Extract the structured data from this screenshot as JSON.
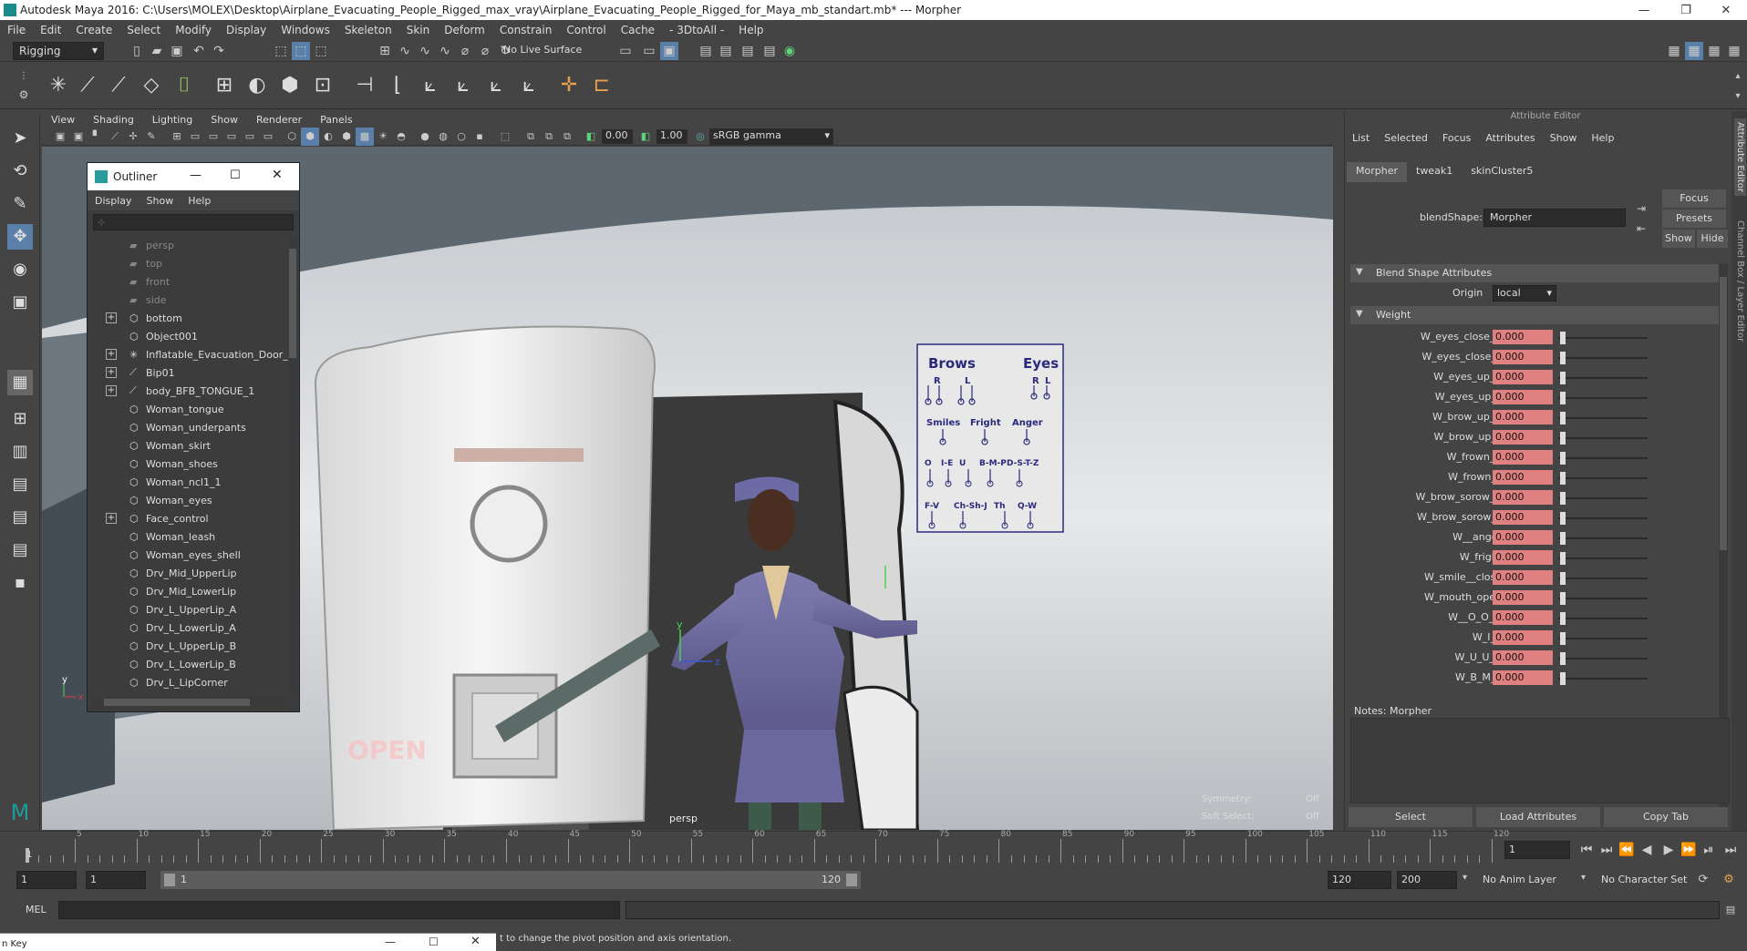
{
  "window": {
    "title": "Autodesk Maya 2016: C:\\Users\\MOLEX\\Desktop\\Airplane_Evacuating_People_Rigged_max_vray\\Airplane_Evacuating_People_Rigged_for_Maya_mb_standart.mb*   ---   Morpher",
    "minimize": "—",
    "restore": "❐",
    "close": "✕"
  },
  "menubar": [
    "File",
    "Edit",
    "Create",
    "Select",
    "Modify",
    "Display",
    "Windows",
    "Skeleton",
    "Skin",
    "Deform",
    "Constrain",
    "Control",
    "Cache",
    "- 3DtoAll -",
    "Help"
  ],
  "toolbar": {
    "mode": "Rigging",
    "live_surface": "No Live Surface"
  },
  "viewport": {
    "menu": [
      "View",
      "Shading",
      "Lighting",
      "Show",
      "Renderer",
      "Panels"
    ],
    "near_value": "0.00",
    "far_value": "1.00",
    "color_space": "sRGB gamma",
    "camera_label": "persp",
    "symmetry_label": "Symmetry:",
    "symmetry_value": "Off",
    "soft_select_label": "Soft Select:",
    "soft_select_value": "Off",
    "axis_y": "y",
    "axis_z": "z",
    "axis_x": "x",
    "face_board": {
      "brows": "Brows",
      "eyes": "Eyes",
      "r1": "R",
      "l1": "L",
      "r2": "R",
      "l2": "L",
      "smiles": "Smiles",
      "fright": "Fright",
      "anger": "Anger",
      "row3": [
        "O",
        "I-E",
        "U",
        "B-M-P",
        "D-S-T-Z"
      ],
      "row4": [
        "F-V",
        "Ch-Sh-J",
        "Th",
        "Q-W"
      ]
    },
    "door_text": "OPEN"
  },
  "outliner": {
    "title": "Outliner",
    "menus": [
      "Display",
      "Show",
      "Help"
    ],
    "items": [
      {
        "label": "persp",
        "icon": "camera-icon",
        "expand": "",
        "dim": true
      },
      {
        "label": "top",
        "icon": "camera-icon",
        "expand": "",
        "dim": true
      },
      {
        "label": "front",
        "icon": "camera-icon",
        "expand": "",
        "dim": true
      },
      {
        "label": "side",
        "icon": "camera-icon",
        "expand": "",
        "dim": true
      },
      {
        "label": "bottom",
        "icon": "mesh-icon",
        "expand": "+",
        "dim": false
      },
      {
        "label": "Object001",
        "icon": "mesh-icon",
        "expand": "",
        "dim": false
      },
      {
        "label": "Inflatable_Evacuation_Door_S",
        "icon": "star-icon",
        "expand": "+",
        "dim": false
      },
      {
        "label": "Bip01",
        "icon": "joint-icon",
        "expand": "+",
        "dim": false
      },
      {
        "label": "body_BFB_TONGUE_1",
        "icon": "joint-icon",
        "expand": "+",
        "dim": false
      },
      {
        "label": "Woman_tongue",
        "icon": "mesh-icon",
        "expand": "",
        "dim": false
      },
      {
        "label": "Woman_underpants",
        "icon": "mesh-icon",
        "expand": "",
        "dim": false
      },
      {
        "label": "Woman_skirt",
        "icon": "mesh-icon",
        "expand": "",
        "dim": false
      },
      {
        "label": "Woman_shoes",
        "icon": "mesh-icon",
        "expand": "",
        "dim": false
      },
      {
        "label": "Woman_ncl1_1",
        "icon": "mesh-icon",
        "expand": "",
        "dim": false
      },
      {
        "label": "Woman_eyes",
        "icon": "mesh-icon",
        "expand": "",
        "dim": false
      },
      {
        "label": "Face_control",
        "icon": "mesh-icon",
        "expand": "+",
        "dim": false
      },
      {
        "label": "Woman_leash",
        "icon": "mesh-icon",
        "expand": "",
        "dim": false
      },
      {
        "label": "Woman_eyes_shell",
        "icon": "mesh-icon",
        "expand": "",
        "dim": false
      },
      {
        "label": "Drv_Mid_UpperLip",
        "icon": "mesh-icon",
        "expand": "",
        "dim": false
      },
      {
        "label": "Drv_Mid_LowerLip",
        "icon": "mesh-icon",
        "expand": "",
        "dim": false
      },
      {
        "label": "Drv_L_UpperLip_A",
        "icon": "mesh-icon",
        "expand": "",
        "dim": false
      },
      {
        "label": "Drv_L_LowerLip_A",
        "icon": "mesh-icon",
        "expand": "",
        "dim": false
      },
      {
        "label": "Drv_L_UpperLip_B",
        "icon": "mesh-icon",
        "expand": "",
        "dim": false
      },
      {
        "label": "Drv_L_LowerLip_B",
        "icon": "mesh-icon",
        "expand": "",
        "dim": false
      },
      {
        "label": "Drv_L_LipCorner",
        "icon": "mesh-icon",
        "expand": "",
        "dim": false
      }
    ]
  },
  "attribute_editor": {
    "title": "Attribute Editor",
    "menus": [
      "List",
      "Selected",
      "Focus",
      "Attributes",
      "Show",
      "Help"
    ],
    "tabs": [
      "Morpher",
      "tweak1",
      "skinCluster5"
    ],
    "active_tab": "Morpher",
    "blendshape_label": "blendShape:",
    "blendshape_value": "Morpher",
    "focus_btn": "Focus",
    "presets_btn": "Presets",
    "show_btn": "Show",
    "hide_btn": "Hide",
    "section_blend": "Blend Shape Attributes",
    "origin_label": "Origin",
    "origin_value": "local",
    "section_weight": "Weight",
    "weights": [
      {
        "name": "W_eyes_close_R",
        "value": "0.000"
      },
      {
        "name": "W_eyes_close_L",
        "value": "0.000"
      },
      {
        "name": "W_eyes_up_R",
        "value": "0.000"
      },
      {
        "name": "W_eyes_up_L",
        "value": "0.000"
      },
      {
        "name": "W_brow_up_R",
        "value": "0.000"
      },
      {
        "name": "W_brow_up_L",
        "value": "0.000"
      },
      {
        "name": "W_frown_R",
        "value": "0.000"
      },
      {
        "name": "W_frown_L",
        "value": "0.000"
      },
      {
        "name": "W_brow_sorow_R",
        "value": "0.000"
      },
      {
        "name": "W_brow_sorow_L",
        "value": "0.000"
      },
      {
        "name": "W__anger",
        "value": "0.000"
      },
      {
        "name": "W_fright",
        "value": "0.000"
      },
      {
        "name": "W_smile__close",
        "value": "0.000"
      },
      {
        "name": "W_mouth_open",
        "value": "0.000"
      },
      {
        "name": "W__O_O_O",
        "value": "0.000"
      },
      {
        "name": "W_I_E",
        "value": "0.000"
      },
      {
        "name": "W_U_U_U",
        "value": "0.000"
      },
      {
        "name": "W_B_M_P",
        "value": "0.000"
      }
    ],
    "notes_label": "Notes:  Morpher",
    "select_btn": "Select",
    "load_btn": "Load Attributes",
    "copy_btn": "Copy Tab",
    "side_tab1": "Attribute Editor",
    "side_tab2": "Channel Box / Layer Editor"
  },
  "timeline": {
    "ticks": [
      "5",
      "10",
      "15",
      "20",
      "25",
      "30",
      "35",
      "40",
      "45",
      "50",
      "55",
      "60",
      "65",
      "70",
      "75",
      "80",
      "85",
      "90",
      "95",
      "100",
      "105",
      "110",
      "115",
      "120"
    ],
    "start_mark": "1",
    "current_frame": "1",
    "end_mark": "120"
  },
  "range": {
    "start": "1",
    "playback_start": "1",
    "slider_start": "1",
    "slider_end": "120",
    "playback_end": "120",
    "end": "200",
    "anim_layer": "No Anim Layer",
    "character_set": "No Character Set"
  },
  "cmdline": {
    "label": "MEL"
  },
  "helpline": {
    "text": "t to change the pivot position and axis orientation.",
    "partial_window": "n Key"
  }
}
